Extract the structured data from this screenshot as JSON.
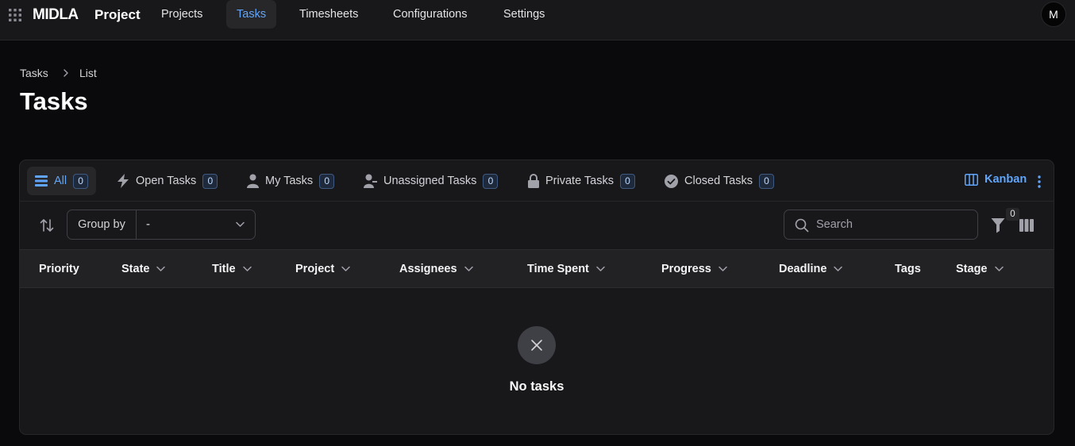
{
  "topbar": {
    "brand": "MIDLA",
    "app_name": "Project",
    "nav": [
      {
        "label": "Projects",
        "active": false
      },
      {
        "label": "Tasks",
        "active": true
      },
      {
        "label": "Timesheets",
        "active": false
      },
      {
        "label": "Configurations",
        "active": false
      },
      {
        "label": "Settings",
        "active": false
      }
    ],
    "avatar_initial": "M"
  },
  "breadcrumb": {
    "parent": "Tasks",
    "current": "List"
  },
  "page_title": "Tasks",
  "tabs": [
    {
      "label": "All",
      "count": "0",
      "icon": "list-icon",
      "active": true
    },
    {
      "label": "Open Tasks",
      "count": "0",
      "icon": "bolt-icon",
      "active": false
    },
    {
      "label": "My Tasks",
      "count": "0",
      "icon": "user-icon",
      "active": false
    },
    {
      "label": "Unassigned Tasks",
      "count": "0",
      "icon": "user-minus-icon",
      "active": false
    },
    {
      "label": "Private Tasks",
      "count": "0",
      "icon": "lock-icon",
      "active": false
    },
    {
      "label": "Closed Tasks",
      "count": "0",
      "icon": "check-circle-icon",
      "active": false
    }
  ],
  "kanban_label": "Kanban",
  "toolbar": {
    "group_by_label": "Group by",
    "group_by_value": "-",
    "search_placeholder": "Search",
    "filter_count": "0"
  },
  "columns": [
    "Priority",
    "State",
    "Title",
    "Project",
    "Assignees",
    "Time Spent",
    "Progress",
    "Deadline",
    "Tags",
    "Stage"
  ],
  "empty_state": {
    "icon": "close-icon",
    "message": "No tasks"
  },
  "colors": {
    "accent": "#60a5fa",
    "background": "#0a0a0c",
    "surface": "#18181b",
    "border": "#27272a"
  }
}
